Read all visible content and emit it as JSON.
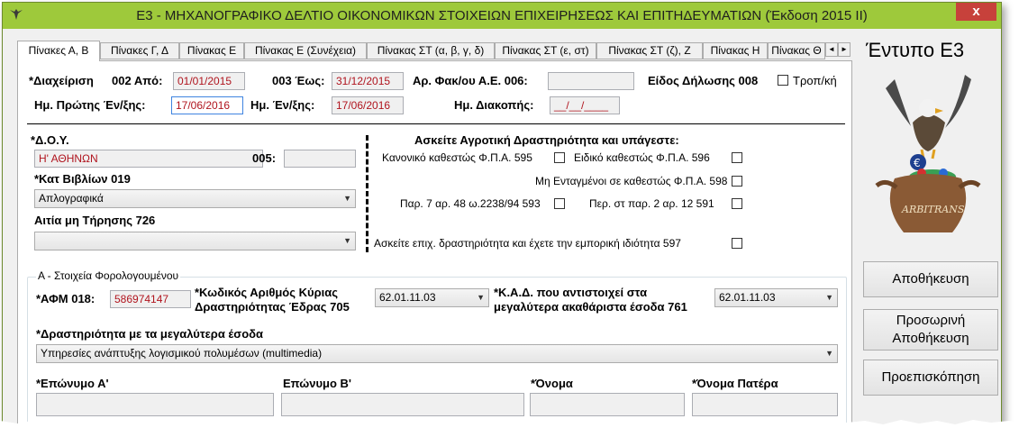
{
  "window": {
    "title": "Ε3 - ΜΗΧΑΝΟΓΡΑΦΙΚΟ ΔΕΛΤΙΟ ΟΙΚΟΝΟΜΙΚΩΝ ΣΤΟΙΧΕΙΩΝ ΕΠΙΧΕΙΡΗΣΕΩΣ ΚΑΙ ΕΠΙΤΗΔΕΥΜΑΤΙΩΝ (Έκδοση 2015 ΙΙ)",
    "close_glyph": "x",
    "titlebar_color": "#9ec93b",
    "close_color": "#c7413b"
  },
  "tabs": [
    {
      "label": "Πίνακες Α, Β"
    },
    {
      "label": "Πίνακες Γ, Δ"
    },
    {
      "label": "Πίνακας Ε"
    },
    {
      "label": "Πίνακας Ε (Συνέχεια)"
    },
    {
      "label": "Πίνακας ΣΤ (α, β, γ, δ)"
    },
    {
      "label": "Πίνακας ΣΤ (ε, στ)"
    },
    {
      "label": "Πίνακας ΣΤ (ζ), Ζ"
    },
    {
      "label": "Πίνακας Η"
    },
    {
      "label": "Πίνακας Θ"
    }
  ],
  "header": {
    "management_label": "*Διαχείριση",
    "from_label": "002 Από:",
    "from_value": "01/01/2015",
    "to_label": "003 Έως:",
    "to_value": "31/12/2015",
    "file_no_label": "Αρ. Φακ/ου Α.Ε. 006:",
    "file_no_value": "",
    "declaration_type_label": "Είδος Δήλωσης 008",
    "amending_label": "Τροπ/κή",
    "first_start_label": "Ημ. Πρώτης Έν/ξης:",
    "first_start_value": "17/06/2016",
    "start_label": "Ημ. Έν/ξης:",
    "start_value": "17/06/2016",
    "stop_label": "Ημ. Διακοπής:",
    "stop_value": "__/__/____"
  },
  "tax": {
    "doy_label": "*Δ.Ο.Υ.",
    "doy_value": "Η' ΑΘΗΝΩΝ",
    "code005_label": "005:",
    "code005_value": "",
    "books_label": "*Κατ Βιβλίων 019",
    "books_value": "Απλογραφικά",
    "reason_label": "Αιτία μη Τήρησης 726",
    "reason_value": ""
  },
  "agri": {
    "title": "Ασκείτε Αγροτική Δραστηριότητα και υπάγεστε:",
    "normal_vat": "Κανονικό καθεστώς Φ.Π.Α. 595",
    "special_vat": "Ειδικό καθεστώς Φ.Π.Α. 596",
    "not_included": "Μη Ενταγμένοι σε καθεστώς Φ.Π.Α. 598",
    "par7": "Παρ. 7 αρ. 48 ω.2238/94 593",
    "par2": "Περ. στ παρ. 2 αρ. 12 591",
    "business_activity": "Ασκείτε επιχ. δραστηριότητα και έχετε την εμπορική ιδιότητα 597"
  },
  "taxpayer": {
    "group_label": "Α - Στοιχεία Φορολογουμένου",
    "afm_label": "*ΑΦΜ 018:",
    "afm_value": "586974147",
    "main_activity_label_1": "*Κωδικός Αριθμός Κύριας",
    "main_activity_label_2": "Δραστηριότητας Έδρας 705",
    "main_activity_value": "62.01.11.03",
    "kad_label_1": "*Κ.Α.Δ. που αντιστοιχεί στα",
    "kad_label_2": "μεγαλύτερα ακαθάριστα έσοδα 761",
    "kad_value": "62.01.11.03",
    "top_activity_label": "*Δραστηριότητα με τα μεγαλύτερα έσοδα",
    "top_activity_value": "Υπηρεσίες ανάπτυξης λογισμικού πολυμέσων (multimedia)",
    "surname_a_label": "*Επώνυμο Α'",
    "surname_b_label": "Επώνυμο Β'",
    "name_label": "*Όνομα",
    "father_label": "*Όνομα Πατέρα"
  },
  "side": {
    "form_title": "Έντυπο Ε3",
    "logo_text": "ARBITRANS",
    "save_label": "Αποθήκευση",
    "temp_save_label_1": "Προσωρινή",
    "temp_save_label_2": "Αποθήκευση",
    "preview_label": "Προεπισκόπηση"
  },
  "icons": {
    "combo_arrow": "▼",
    "tab_left": "◄",
    "tab_right": "►"
  }
}
